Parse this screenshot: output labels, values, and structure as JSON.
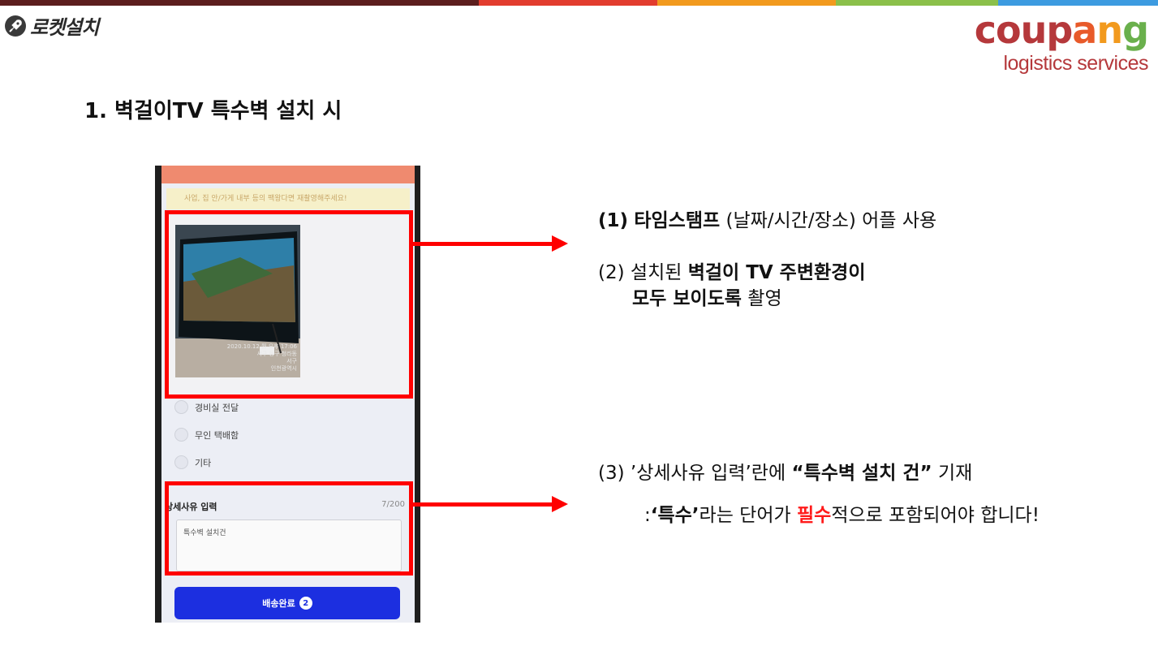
{
  "topbar_colors": [
    "#5c1e1e",
    "#e23c2e",
    "#f29a1e",
    "#8bc04a",
    "#3d9be0"
  ],
  "brand": {
    "icon": "rocket-icon",
    "name": "로켓설치"
  },
  "logo": {
    "letters": [
      {
        "ch": "c",
        "color": "#b5383b"
      },
      {
        "ch": "o",
        "color": "#b5383b"
      },
      {
        "ch": "u",
        "color": "#b5383b"
      },
      {
        "ch": "p",
        "color": "#b5383b"
      },
      {
        "ch": "a",
        "color": "#e85a2a"
      },
      {
        "ch": "n",
        "color": "#f29a1e"
      },
      {
        "ch": "g",
        "color": "#6ab04c"
      }
    ],
    "subtitle": "logistics services"
  },
  "title": "1. 벽걸이TV 특수벽 설치 시",
  "phone": {
    "notice": "사업, 집 안/가게 내부 등의 팩왕다면 재촬영해주세요!",
    "photo_stamp": [
      "2020.10.12 월 오후 17:06",
      "서구 동구 청라동",
      "서구",
      "인천광역시"
    ],
    "options": [
      "경비실 전달",
      "무인 택배함",
      "기타"
    ],
    "detail_label": "상세사유 입력",
    "detail_count": "7/200",
    "detail_value": "특수벽 설치건",
    "button_label": "배송완료",
    "button_badge": "2"
  },
  "notes": {
    "n1_num": "(1)",
    "n1_bold": "타임스탬프",
    "n1_rest": "(날짜/시간/장소) 어플 사용",
    "n2_num": "(2)",
    "n2_pre": "설치된",
    "n2_bold1": "벽걸이 TV 주변환경이",
    "n2_bold2": "모두 보이도록",
    "n2_rest": "촬영",
    "n3_num": "(3)",
    "n3_pre": "’상세사유 입력’란에",
    "n3_bold": "“특수벽 설치 건”",
    "n3_rest": "기재",
    "n4_pre": ":",
    "n4_bold": "‘특수’",
    "n4_mid": "라는 단어가",
    "n4_red": "필수",
    "n4_rest": "적으로 포함되어야 합니다!"
  }
}
